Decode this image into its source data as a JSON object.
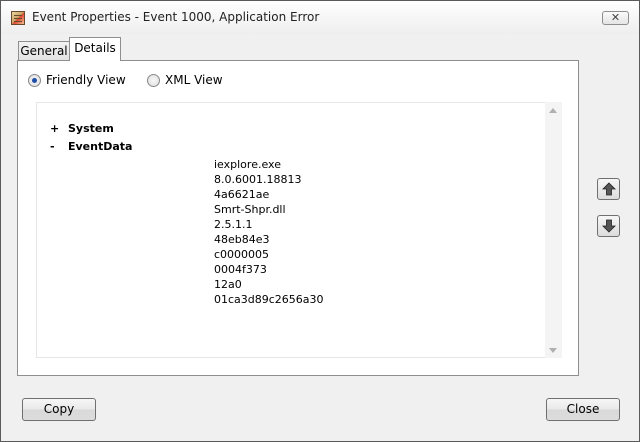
{
  "window": {
    "title": "Event Properties - Event 1000, Application Error",
    "close_glyph": "✕"
  },
  "tabs": [
    {
      "label": "General",
      "selected": false
    },
    {
      "label": "Details",
      "selected": true
    }
  ],
  "view_options": {
    "friendly_label": "Friendly View",
    "xml_label": "XML View",
    "selected": "friendly"
  },
  "tree": {
    "system": {
      "sign": "+",
      "label": "System"
    },
    "eventdata": {
      "sign": "-",
      "label": "EventData"
    },
    "values": [
      "iexplore.exe",
      "8.0.6001.18813",
      "4a6621ae",
      "Smrt-Shpr.dll",
      "2.5.1.1",
      "48eb84e3",
      "c0000005",
      "0004f373",
      "12a0",
      "01ca3d89c2656a30"
    ]
  },
  "icons": {
    "window": "event-properties-icon",
    "nav_up": "arrow-up-icon",
    "nav_down": "arrow-down-icon"
  },
  "buttons": {
    "copy_label": "Copy",
    "close_label": "Close"
  }
}
